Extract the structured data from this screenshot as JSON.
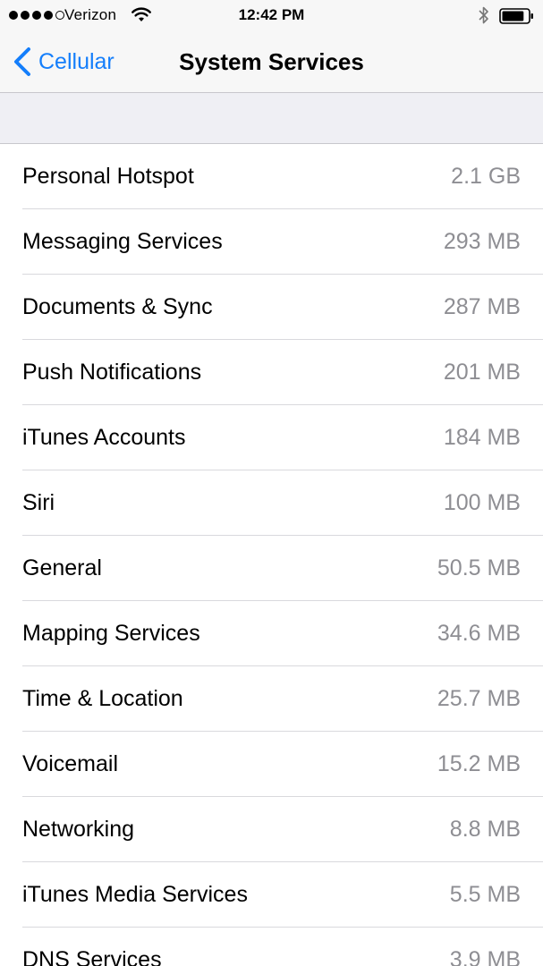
{
  "status_bar": {
    "carrier": "Verizon",
    "time": "12:42 PM",
    "signal_bars_filled": 4,
    "signal_bars_total": 5,
    "battery_level": 0.85
  },
  "nav": {
    "back_label": "Cellular",
    "title": "System Services"
  },
  "services": [
    {
      "name": "Personal Hotspot",
      "usage": "2.1 GB"
    },
    {
      "name": "Messaging Services",
      "usage": "293 MB"
    },
    {
      "name": "Documents & Sync",
      "usage": "287 MB"
    },
    {
      "name": "Push Notifications",
      "usage": "201 MB"
    },
    {
      "name": "iTunes Accounts",
      "usage": "184 MB"
    },
    {
      "name": "Siri",
      "usage": "100 MB"
    },
    {
      "name": "General",
      "usage": "50.5 MB"
    },
    {
      "name": "Mapping Services",
      "usage": "34.6 MB"
    },
    {
      "name": "Time & Location",
      "usage": "25.7 MB"
    },
    {
      "name": "Voicemail",
      "usage": "15.2 MB"
    },
    {
      "name": "Networking",
      "usage": "8.8 MB"
    },
    {
      "name": "iTunes Media Services",
      "usage": "5.5 MB"
    },
    {
      "name": "DNS Services",
      "usage": "3.9 MB"
    }
  ],
  "colors": {
    "accent": "#147efb",
    "value_text": "#8e8e93",
    "background": "#efeff4",
    "separator": "#c8c7cc"
  },
  "icons": [
    "wifi-icon",
    "bluetooth-icon",
    "battery-icon",
    "back-chevron-icon"
  ]
}
